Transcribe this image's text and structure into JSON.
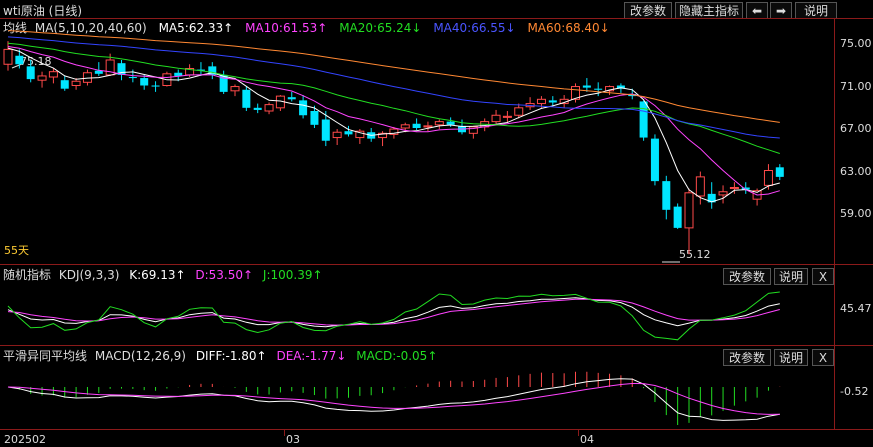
{
  "header": {
    "title": "wti原油 (日线)"
  },
  "toolbar": {
    "change_params": "改参数",
    "hide_indicator": "隐藏主指标",
    "left": "⬅",
    "right": "➡",
    "help": "说明",
    "close": "X"
  },
  "price_panel": {
    "label": "均线",
    "ma_name": "MA(5,10,20,40,60)",
    "ma5": "MA5:62.33↑",
    "ma10": "MA10:61.53↑",
    "ma20": "MA20:65.24↓",
    "ma40": "MA40:66.55↓",
    "ma60": "MA60:68.40↓",
    "days": "55天",
    "high_label": "75.18",
    "low_label": "55.12",
    "y_ticks": [
      "75.00",
      "71.00",
      "67.00",
      "63.00",
      "59.00"
    ]
  },
  "kdj_panel": {
    "label": "随机指标",
    "name": "KDJ(9,3,3)",
    "k": "K:69.13↑",
    "d": "D:53.50↑",
    "j": "J:100.39↑",
    "y_ticks": [
      "45.47"
    ]
  },
  "macd_panel": {
    "label": "平滑异同平均线",
    "name": "MACD(12,26,9)",
    "diff": "DIFF:-1.80↑",
    "dea": "DEA:-1.77↓",
    "macd": "MACD:-0.05↑",
    "y_ticks": [
      "-0.52"
    ]
  },
  "x_axis": [
    "202502",
    "03",
    "04"
  ],
  "colors": {
    "up": "#ff4a4a",
    "down": "#00e5ff",
    "ma5": "#ffffff",
    "ma10": "#ff44ff",
    "ma20": "#22dd22",
    "ma40": "#3344ff",
    "ma60": "#ff8833",
    "k": "#ffffff",
    "d": "#ff44ff",
    "j": "#22dd22"
  },
  "chart_data": {
    "type": "candlestick",
    "ylim": [
      55,
      76
    ],
    "candles": [
      {
        "o": 73.0,
        "h": 75.18,
        "l": 72.4,
        "c": 74.4
      },
      {
        "o": 73.8,
        "h": 74.4,
        "l": 72.6,
        "c": 73.0
      },
      {
        "o": 72.8,
        "h": 73.4,
        "l": 71.3,
        "c": 71.6
      },
      {
        "o": 71.5,
        "h": 72.3,
        "l": 70.8,
        "c": 71.9
      },
      {
        "o": 71.8,
        "h": 72.6,
        "l": 71.2,
        "c": 72.3
      },
      {
        "o": 71.5,
        "h": 71.9,
        "l": 70.5,
        "c": 70.7
      },
      {
        "o": 71.0,
        "h": 71.7,
        "l": 70.6,
        "c": 71.4
      },
      {
        "o": 71.3,
        "h": 72.5,
        "l": 71.0,
        "c": 72.2
      },
      {
        "o": 72.4,
        "h": 73.2,
        "l": 71.9,
        "c": 72.1
      },
      {
        "o": 72.0,
        "h": 74.0,
        "l": 71.9,
        "c": 73.4
      },
      {
        "o": 73.1,
        "h": 73.4,
        "l": 71.5,
        "c": 72.0
      },
      {
        "o": 71.8,
        "h": 72.5,
        "l": 71.3,
        "c": 71.7
      },
      {
        "o": 71.7,
        "h": 72.0,
        "l": 70.6,
        "c": 71.0
      },
      {
        "o": 71.0,
        "h": 71.4,
        "l": 70.4,
        "c": 70.9
      },
      {
        "o": 71.0,
        "h": 72.3,
        "l": 70.9,
        "c": 72.1
      },
      {
        "o": 72.2,
        "h": 72.5,
        "l": 71.4,
        "c": 71.9
      },
      {
        "o": 72.0,
        "h": 73.0,
        "l": 71.8,
        "c": 72.6
      },
      {
        "o": 72.5,
        "h": 73.2,
        "l": 71.9,
        "c": 72.4
      },
      {
        "o": 72.8,
        "h": 73.2,
        "l": 71.6,
        "c": 72.0
      },
      {
        "o": 72.0,
        "h": 72.4,
        "l": 70.2,
        "c": 70.4
      },
      {
        "o": 70.5,
        "h": 71.1,
        "l": 70.0,
        "c": 70.9
      },
      {
        "o": 70.6,
        "h": 70.9,
        "l": 68.6,
        "c": 68.9
      },
      {
        "o": 68.9,
        "h": 69.3,
        "l": 68.4,
        "c": 68.7
      },
      {
        "o": 68.6,
        "h": 69.4,
        "l": 68.3,
        "c": 69.2
      },
      {
        "o": 68.9,
        "h": 70.1,
        "l": 68.6,
        "c": 70.0
      },
      {
        "o": 69.9,
        "h": 70.4,
        "l": 69.5,
        "c": 69.7
      },
      {
        "o": 69.6,
        "h": 70.1,
        "l": 67.9,
        "c": 68.2
      },
      {
        "o": 68.6,
        "h": 69.1,
        "l": 67.0,
        "c": 67.3
      },
      {
        "o": 67.8,
        "h": 68.6,
        "l": 65.3,
        "c": 65.8
      },
      {
        "o": 66.1,
        "h": 66.9,
        "l": 65.4,
        "c": 66.6
      },
      {
        "o": 66.7,
        "h": 67.2,
        "l": 66.2,
        "c": 66.4
      },
      {
        "o": 66.1,
        "h": 66.9,
        "l": 65.5,
        "c": 66.7
      },
      {
        "o": 66.6,
        "h": 67.0,
        "l": 65.7,
        "c": 66.0
      },
      {
        "o": 66.1,
        "h": 66.7,
        "l": 65.3,
        "c": 66.5
      },
      {
        "o": 66.4,
        "h": 67.1,
        "l": 66.0,
        "c": 66.9
      },
      {
        "o": 67.0,
        "h": 67.5,
        "l": 66.6,
        "c": 67.3
      },
      {
        "o": 67.4,
        "h": 67.9,
        "l": 66.8,
        "c": 67.0
      },
      {
        "o": 67.1,
        "h": 67.6,
        "l": 66.7,
        "c": 67.2
      },
      {
        "o": 67.3,
        "h": 67.8,
        "l": 66.9,
        "c": 67.6
      },
      {
        "o": 67.6,
        "h": 68.0,
        "l": 67.1,
        "c": 67.3
      },
      {
        "o": 67.2,
        "h": 67.8,
        "l": 66.4,
        "c": 66.6
      },
      {
        "o": 66.5,
        "h": 67.2,
        "l": 66.0,
        "c": 67.1
      },
      {
        "o": 67.1,
        "h": 67.9,
        "l": 66.7,
        "c": 67.6
      },
      {
        "o": 67.6,
        "h": 68.7,
        "l": 67.4,
        "c": 68.2
      },
      {
        "o": 68.0,
        "h": 68.6,
        "l": 67.5,
        "c": 68.1
      },
      {
        "o": 68.2,
        "h": 69.3,
        "l": 67.9,
        "c": 68.9
      },
      {
        "o": 69.0,
        "h": 69.9,
        "l": 68.7,
        "c": 69.3
      },
      {
        "o": 69.3,
        "h": 70.0,
        "l": 68.9,
        "c": 69.7
      },
      {
        "o": 69.6,
        "h": 70.0,
        "l": 69.1,
        "c": 69.4
      },
      {
        "o": 69.3,
        "h": 70.1,
        "l": 68.9,
        "c": 69.7
      },
      {
        "o": 69.7,
        "h": 71.2,
        "l": 69.4,
        "c": 70.9
      },
      {
        "o": 71.0,
        "h": 71.7,
        "l": 70.4,
        "c": 70.8
      },
      {
        "o": 70.7,
        "h": 71.3,
        "l": 70.0,
        "c": 70.6
      },
      {
        "o": 70.5,
        "h": 71.0,
        "l": 70.1,
        "c": 70.9
      },
      {
        "o": 71.0,
        "h": 71.2,
        "l": 70.3,
        "c": 70.7
      },
      {
        "o": 70.2,
        "h": 70.7,
        "l": 69.7,
        "c": 70.0
      },
      {
        "o": 69.5,
        "h": 69.6,
        "l": 65.8,
        "c": 66.1
      },
      {
        "o": 66.0,
        "h": 66.4,
        "l": 61.6,
        "c": 62.0
      },
      {
        "o": 62.0,
        "h": 62.5,
        "l": 58.4,
        "c": 59.3
      },
      {
        "o": 59.6,
        "h": 59.9,
        "l": 57.5,
        "c": 57.6
      },
      {
        "o": 57.6,
        "h": 61.3,
        "l": 55.12,
        "c": 60.9
      },
      {
        "o": 60.6,
        "h": 62.9,
        "l": 59.8,
        "c": 62.4
      },
      {
        "o": 60.8,
        "h": 61.9,
        "l": 59.4,
        "c": 60.0
      },
      {
        "o": 60.7,
        "h": 61.6,
        "l": 59.9,
        "c": 61.0
      },
      {
        "o": 61.3,
        "h": 61.9,
        "l": 60.8,
        "c": 61.4
      },
      {
        "o": 61.4,
        "h": 61.9,
        "l": 60.8,
        "c": 61.2
      },
      {
        "o": 60.3,
        "h": 61.3,
        "l": 59.7,
        "c": 61.1
      },
      {
        "o": 61.6,
        "h": 63.6,
        "l": 61.2,
        "c": 63.0
      },
      {
        "o": 63.3,
        "h": 63.6,
        "l": 62.1,
        "c": 62.4
      }
    ]
  }
}
